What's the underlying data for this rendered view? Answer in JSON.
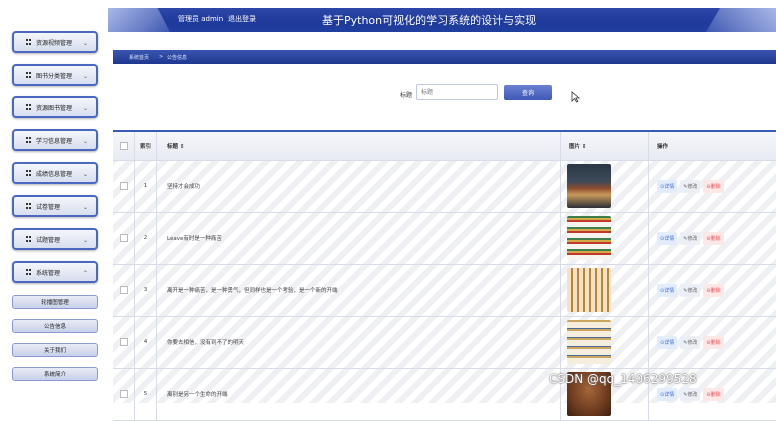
{
  "header": {
    "admin_label": "管理员 admin",
    "logout_label": "退出登录",
    "site_title": "基于Python可视化的学习系统的设计与实现"
  },
  "sidebar": {
    "items": [
      {
        "label": "资源视频管理"
      },
      {
        "label": "图书分类管理"
      },
      {
        "label": "资源图书管理"
      },
      {
        "label": "学习信息管理"
      },
      {
        "label": "成绩信息管理"
      },
      {
        "label": "试卷管理"
      },
      {
        "label": "试题管理"
      },
      {
        "label": "系统管理"
      }
    ],
    "subitems": [
      {
        "label": "轮播图管理"
      },
      {
        "label": "公告信息"
      },
      {
        "label": "关于我们"
      },
      {
        "label": "系统简介"
      }
    ]
  },
  "breadcrumb": {
    "home": "系统首页",
    "sep": ">",
    "current": "公告信息"
  },
  "search": {
    "label": "标题",
    "placeholder": "标题",
    "button": "查询"
  },
  "table": {
    "headers": {
      "index": "索引",
      "title": "标题 ⇕",
      "image": "图片 ⇕",
      "action": "操作"
    },
    "actions": {
      "detail": "⊙详情",
      "edit": "✎修改",
      "delete": "⊖删除"
    },
    "rows": [
      {
        "index": "1",
        "title": "坚持才会成功"
      },
      {
        "index": "2",
        "title": "Leave有时是一种痛苦"
      },
      {
        "index": "3",
        "title": "离开是一种痛苦，是一种勇气，但同样也是一个考验，是一个新的开端"
      },
      {
        "index": "4",
        "title": "你要去相信，没有到不了的明天"
      },
      {
        "index": "5",
        "title": "离别是另一个生命的开端"
      }
    ]
  },
  "watermark": "CSDN @qq_1406299528"
}
